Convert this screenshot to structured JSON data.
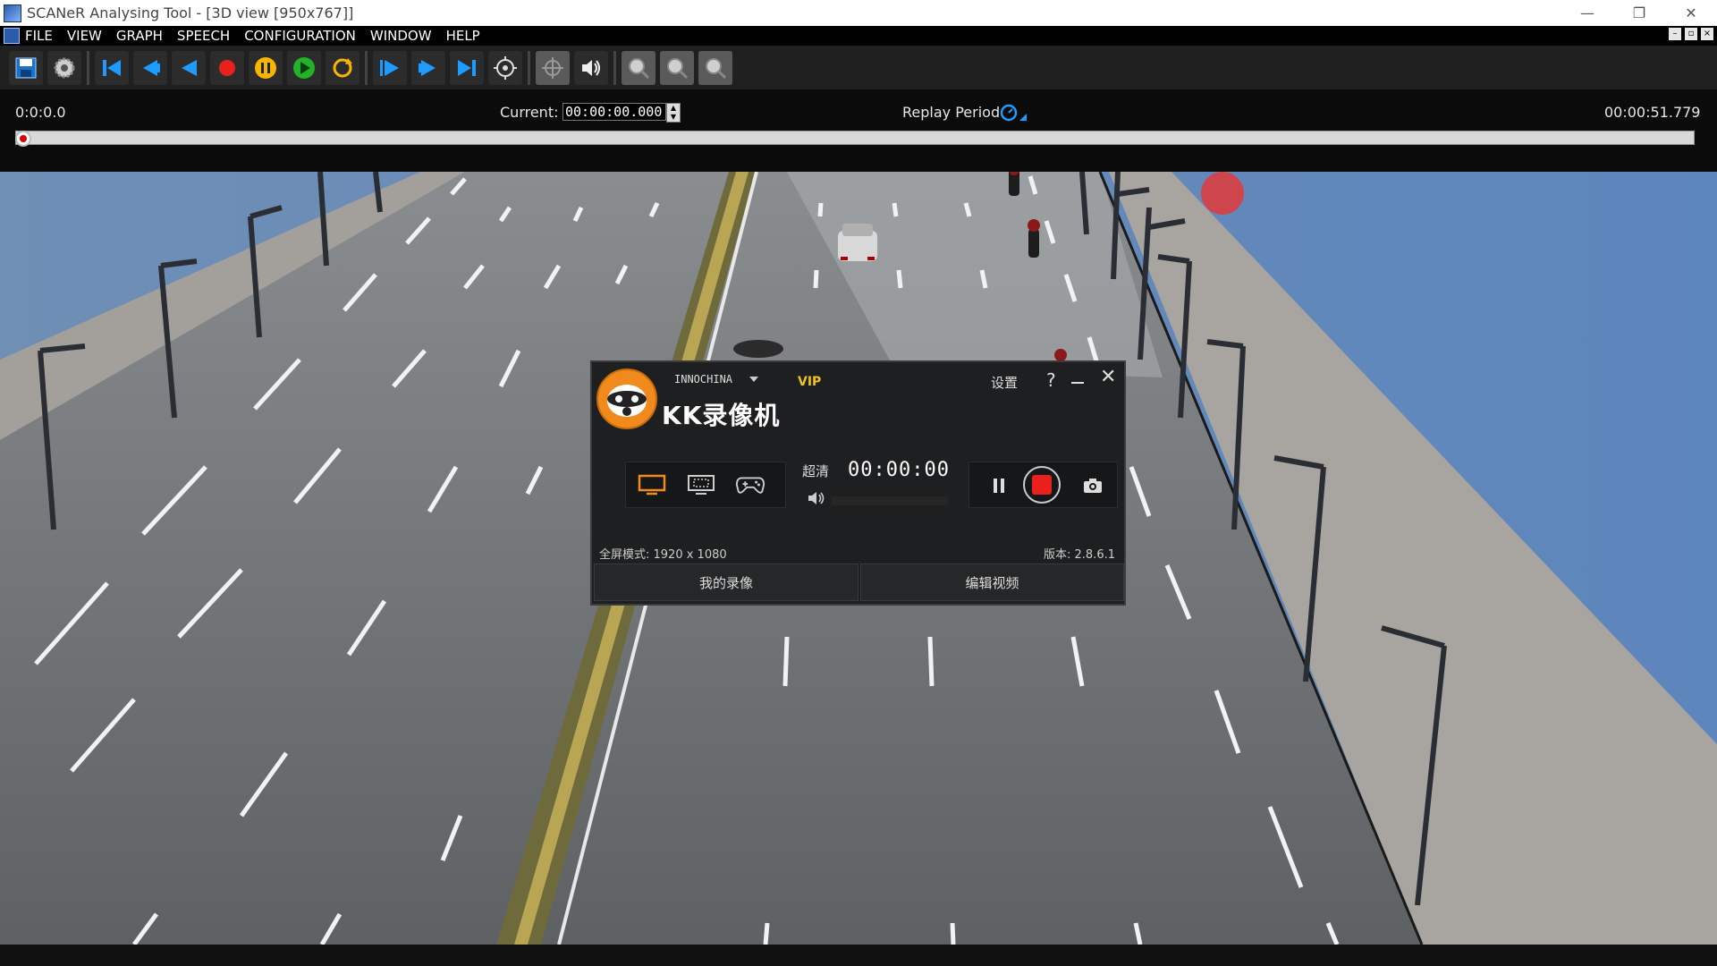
{
  "window": {
    "title": "SCANeR Analysing Tool - [3D view [950x767]]",
    "controls": {
      "minimize": "—",
      "restore": "❐",
      "close": "✕"
    }
  },
  "menu": {
    "items": [
      "FILE",
      "VIEW",
      "GRAPH",
      "SPEECH",
      "CONFIGURATION",
      "WINDOW",
      "HELP"
    ],
    "mdi_controls": {
      "minimize": "–",
      "restore": "▫",
      "close": "×"
    }
  },
  "toolbar": {
    "buttons": [
      "save-icon",
      "settings-gear-icon",
      "skip-to-start-icon",
      "step-back-icon",
      "play-reverse-icon",
      "record-icon",
      "pause-icon",
      "play-icon",
      "loop-icon",
      "play-forward-icon",
      "step-forward-icon",
      "skip-to-end-icon",
      "target-icon",
      "crosshair-icon",
      "volume-icon",
      "zoom-xy-icon",
      "zoom-x-icon",
      "zoom-y-icon"
    ]
  },
  "timeline": {
    "start_time": "0:0:0.0",
    "current_label": "Current:",
    "current_value": "00:00:00.000",
    "replay_period_label": "Replay Period",
    "end_time": "00:00:51.779",
    "position": 0.0
  },
  "recorder": {
    "account": "INNOCHINA",
    "vip": "VIP",
    "app_name": "KK录像机",
    "settings": "设置",
    "help": "?",
    "close": "✕",
    "quality": "超清",
    "timer": "00:00:00",
    "mode_text": "全屏模式: 1920 x 1080",
    "version": "版本: 2.8.6.1",
    "my_recordings": "我的录像",
    "edit_video": "编辑视频",
    "accent_color": "#e8211c",
    "brand_color": "#f08a1c"
  }
}
